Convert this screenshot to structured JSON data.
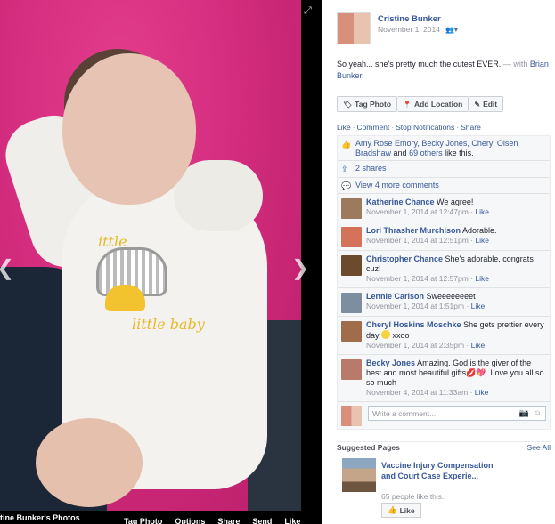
{
  "photo": {
    "album_title": "tine Bunker's Photos",
    "actions": [
      "Tag Photo",
      "Options",
      "Share",
      "Send",
      "Like"
    ],
    "printed_labels": [
      "ittle",
      "little baby"
    ]
  },
  "post": {
    "author": "Cristine Bunker",
    "date": "November 1, 2014",
    "caption": "So yeah... she's pretty much the cutest EVER.",
    "with_prefix": "— with",
    "with_name": "Brian Bunker.",
    "buttons": {
      "tag_photo": "Tag Photo",
      "add_location": "Add Location",
      "edit": "Edit"
    },
    "actions": {
      "like": "Like",
      "comment": "Comment",
      "stop_notifications": "Stop Notifications",
      "share": "Share"
    }
  },
  "ufi": {
    "likes_text_names": "Amy Rose Emory, Becky Jones, Cheryl Olsen Bradshaw",
    "likes_text_and": "and",
    "likes_text_others": "69 others",
    "likes_text_tail": "like this.",
    "shares": "2 shares",
    "view_more": "View 4 more comments",
    "comments": [
      {
        "name": "Katherine Chance",
        "text": "We agree!",
        "time": "November 1, 2014 at 12:47pm",
        "like": "Like",
        "avatar_color": "#9c7a5e"
      },
      {
        "name": "Lori Thrasher Murchison",
        "text": "Adorable.",
        "time": "November 1, 2014 at 12:51pm",
        "like": "Like",
        "avatar_color": "#d4725a"
      },
      {
        "name": "Christopher Chance",
        "text": "She's adorable, congrats cuz!",
        "time": "November 1, 2014 at 12:57pm",
        "like": "Like",
        "avatar_color": "#6b4a2e"
      },
      {
        "name": "Lennie Carlson",
        "text": "Sweeeeeeeet",
        "time": "November 1, 2014 at 1:51pm",
        "like": "Like",
        "avatar_color": "#7d8ea0"
      },
      {
        "name": "Cheryl Hoskins Moschke",
        "text": "She gets prettier every day",
        "text_after": "xxoo",
        "time": "November 1, 2014 at 2:35pm",
        "like": "Like",
        "avatar_color": "#a06c4a"
      },
      {
        "name": "Becky Jones",
        "text": "Amazing. God is the giver of the best and most beautiful gifts",
        "text_after": ". Love you all so so much",
        "time": "November 4, 2014 at 11:33am",
        "like": "Like",
        "avatar_color": "#b87a6a"
      }
    ],
    "write_placeholder": "Write a comment..."
  },
  "suggested": {
    "heading": "Suggested Pages",
    "see_all": "See All",
    "page_title": "Vaccine Injury Compensation and Court Case Experie...",
    "page_likes": "65 people like this.",
    "like_button": "Like"
  }
}
